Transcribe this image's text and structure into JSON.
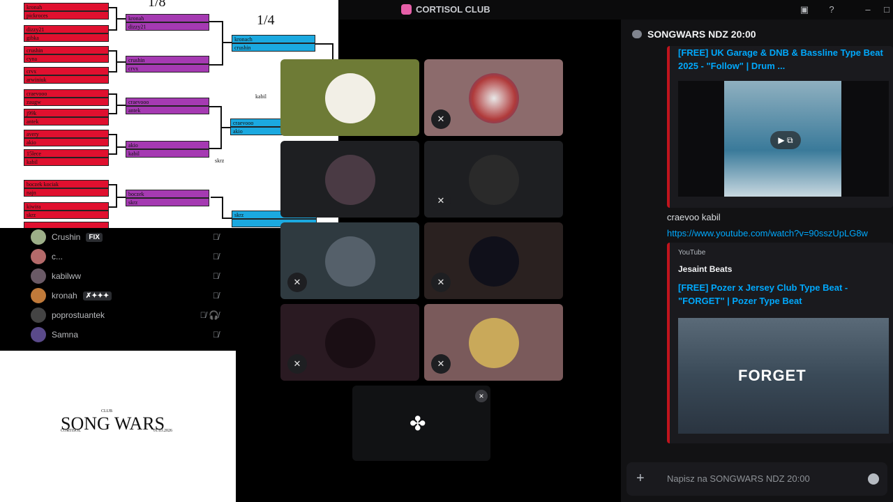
{
  "window": {
    "title": "CORTISOL CLUB",
    "icons": [
      "inbox-icon",
      "help-icon",
      "minimize-icon",
      "maximize-icon"
    ]
  },
  "bracket": {
    "round_labels": [
      "1/8",
      "1/4"
    ],
    "round16": [
      "kronah",
      "pickroces",
      "dizzy21",
      "gibka",
      "crushin",
      "cyna",
      "crvx",
      "arwiniuk",
      "craevooo",
      "zaugw",
      "j99k",
      "antek",
      "avery",
      "akio",
      "15lece",
      "kabil",
      "boczek kociak",
      "najn",
      "kiwira",
      "skrz",
      ""
    ],
    "eighths": [
      "kronah",
      "dizzy21",
      "crushin",
      "crvx",
      "craevooo",
      "antek",
      "akio",
      "kabil",
      "boczek",
      "skrz"
    ],
    "quarters": [
      "kronach",
      "crushin",
      "craevooo",
      "akio",
      "skrz",
      ""
    ],
    "notes": [
      "kabil",
      "skrz"
    ]
  },
  "members": [
    {
      "name": "Crushin",
      "badge": "FIX"
    },
    {
      "name": "c..."
    },
    {
      "name": "kabilww"
    },
    {
      "name": "kronah",
      "badge": "✗✦✦✦"
    },
    {
      "name": "poprostuantek"
    },
    {
      "name": "Samna"
    }
  ],
  "songwars": {
    "club": "CLUB",
    "title": "SONG WARS",
    "brand": "CORTISOL",
    "date": "01.03.2026"
  },
  "tiles": [
    {
      "bg": "#6e7b36",
      "muted": false
    },
    {
      "bg": "#8c6b6c",
      "muted": true
    },
    {
      "bg": "#1e1f22",
      "muted": false
    },
    {
      "bg": "#1e1f22",
      "muted": true
    },
    {
      "bg": "#2f3a40",
      "muted": true
    },
    {
      "bg": "#2a2120",
      "muted": true
    },
    {
      "bg": "#2a1a22",
      "muted": true
    },
    {
      "bg": "#7a5a5b",
      "muted": true
    }
  ],
  "chat": {
    "channel": "SONGWARS NDZ 20:00",
    "embed1_title": "[FREE] UK Garage & DNB & Bassline Type Beat 2025 - \"Follow\" | Drum ...",
    "message_author": "craevoo kabil",
    "message_link": "https://www.youtube.com/watch?v=90sszUpLG8w",
    "embed2_provider": "YouTube",
    "embed2_author": "Jesaint Beats",
    "embed2_title": "[FREE] Pozer x Jersey Club Type Beat - \"FORGET\" | Pozer Type Beat",
    "thumb2_text": "FORGET",
    "input_placeholder": "Napisz na SONGWARS NDZ 20:00",
    "colors": {
      "link": "#00a8fc",
      "embed_bar": "#c0141d"
    }
  }
}
